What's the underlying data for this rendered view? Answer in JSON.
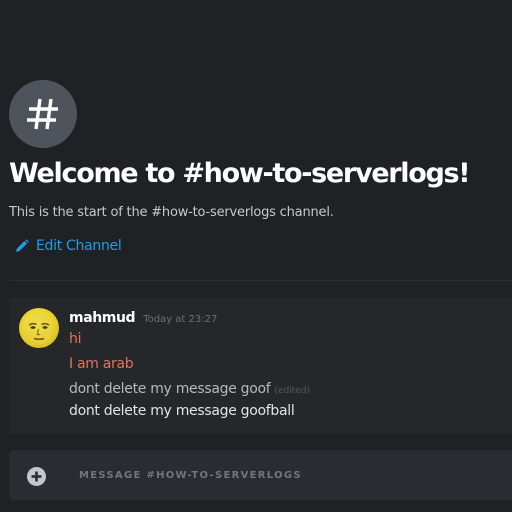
{
  "channel": {
    "icon": "hashtag-icon",
    "welcome_title": "Welcome to #how-to-serverlogs!",
    "welcome_subtitle": "This is the start of the #how-to-serverlogs channel.",
    "edit_label": "Edit Channel",
    "edit_icon": "pencil-icon"
  },
  "message": {
    "author": "mahmud",
    "timestamp": "Today at 23:27",
    "avatar_icon": "face-avatar-icon",
    "lines": [
      {
        "text": "hi",
        "color": "#e1755b"
      },
      {
        "text": "I am arab",
        "color": "#e1755b"
      },
      {
        "text": "dont delete my message goof",
        "edited": "(edited)",
        "color": "#b6b8bc"
      },
      {
        "text": "dont delete my message goofball",
        "color": "#e2e3e5"
      }
    ]
  },
  "composer": {
    "add_icon": "plus-circle-icon",
    "placeholder": "MESSAGE #HOW-TO-SERVERLOGS",
    "value": ""
  },
  "colors": {
    "background": "#1f2125",
    "message_background": "#25272b",
    "composer_background": "#2a2c31",
    "accent": "#1f9fe4",
    "highlight_text": "#e1755b"
  }
}
